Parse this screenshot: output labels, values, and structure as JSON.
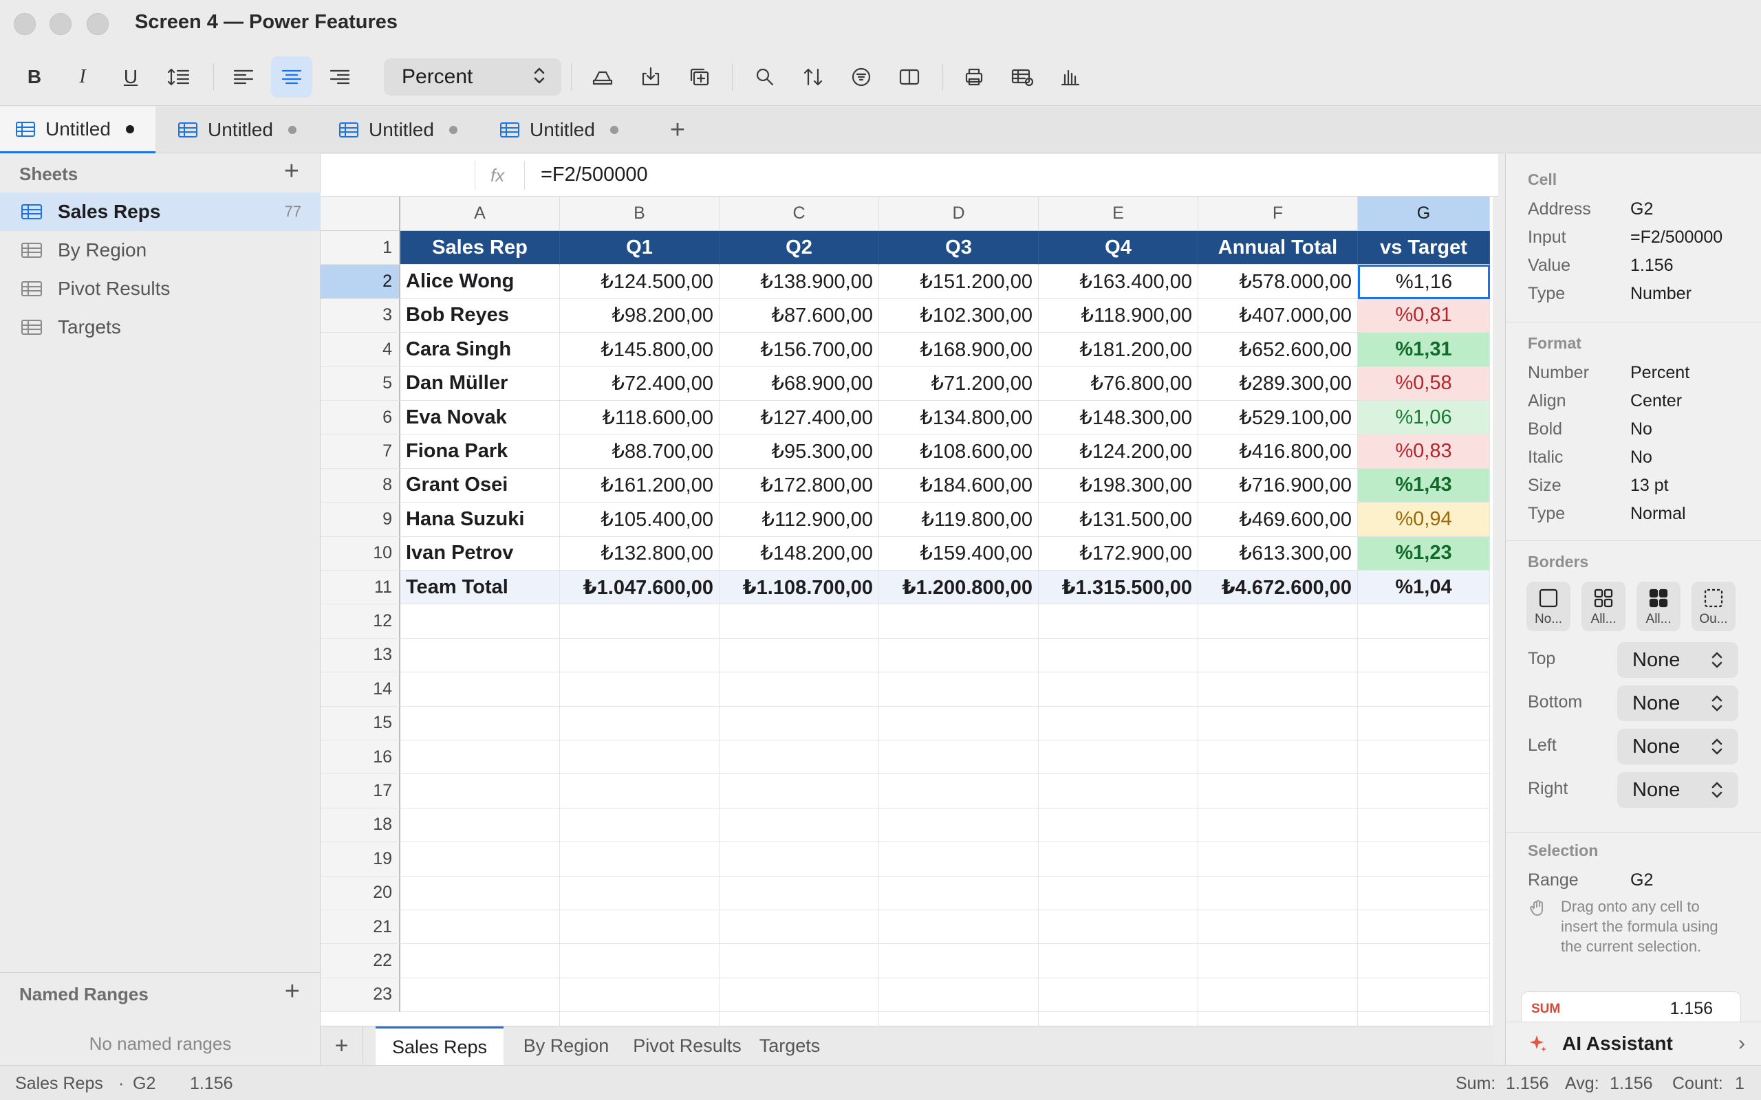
{
  "window": {
    "title": "Screen 4 — Power Features"
  },
  "toolbar": {
    "bold": "B",
    "italic": "I",
    "underline": "U",
    "number_format": "Percent",
    "colors": {
      "active_bg": "#d4e4f8",
      "accent": "#1a73e8"
    }
  },
  "doc_tabs": [
    {
      "label": "Untitled",
      "active": true
    },
    {
      "label": "Untitled",
      "active": false
    },
    {
      "label": "Untitled",
      "active": false
    },
    {
      "label": "Untitled",
      "active": false
    }
  ],
  "sidebar": {
    "header": "Sheets",
    "items": [
      {
        "label": "Sales Reps",
        "count": "77",
        "active": true
      },
      {
        "label": "By Region",
        "count": "",
        "active": false
      },
      {
        "label": "Pivot Results",
        "count": "",
        "active": false
      },
      {
        "label": "Targets",
        "count": "",
        "active": false
      }
    ],
    "named_ranges": {
      "header": "Named Ranges",
      "empty": "No named ranges"
    }
  },
  "formula_bar": {
    "fx": "fx",
    "formula": "=F2/500000"
  },
  "grid": {
    "columns": [
      "A",
      "B",
      "C",
      "D",
      "E",
      "F",
      "G"
    ],
    "selected_column": "G",
    "selected_row": 2,
    "row_numbers": [
      "1",
      "2",
      "3",
      "4",
      "5",
      "6",
      "7",
      "8",
      "9",
      "10",
      "11",
      "12",
      "13",
      "14",
      "15",
      "16",
      "17",
      "18",
      "19",
      "20",
      "21",
      "22",
      "23"
    ],
    "header": [
      "Sales Rep",
      "Q1",
      "Q2",
      "Q3",
      "Q4",
      "Annual Total",
      "vs Target"
    ],
    "rows": [
      {
        "name": "Alice Wong",
        "q": [
          "₺124.500,00",
          "₺138.900,00",
          "₺151.200,00",
          "₺163.400,00"
        ],
        "total": "₺578.000,00",
        "vs": "%1,16",
        "status": "active"
      },
      {
        "name": "Bob Reyes",
        "q": [
          "₺98.200,00",
          "₺87.600,00",
          "₺102.300,00",
          "₺118.900,00"
        ],
        "total": "₺407.000,00",
        "vs": "%0,81",
        "status": "bad"
      },
      {
        "name": "Cara Singh",
        "q": [
          "₺145.800,00",
          "₺156.700,00",
          "₺168.900,00",
          "₺181.200,00"
        ],
        "total": "₺652.600,00",
        "vs": "%1,31",
        "status": "great"
      },
      {
        "name": "Dan Müller",
        "q": [
          "₺72.400,00",
          "₺68.900,00",
          "₺71.200,00",
          "₺76.800,00"
        ],
        "total": "₺289.300,00",
        "vs": "%0,58",
        "status": "bad"
      },
      {
        "name": "Eva Novak",
        "q": [
          "₺118.600,00",
          "₺127.400,00",
          "₺134.800,00",
          "₺148.300,00"
        ],
        "total": "₺529.100,00",
        "vs": "%1,06",
        "status": "ok"
      },
      {
        "name": "Fiona Park",
        "q": [
          "₺88.700,00",
          "₺95.300,00",
          "₺108.600,00",
          "₺124.200,00"
        ],
        "total": "₺416.800,00",
        "vs": "%0,83",
        "status": "bad"
      },
      {
        "name": "Grant Osei",
        "q": [
          "₺161.200,00",
          "₺172.800,00",
          "₺184.600,00",
          "₺198.300,00"
        ],
        "total": "₺716.900,00",
        "vs": "%1,43",
        "status": "great"
      },
      {
        "name": "Hana Suzuki",
        "q": [
          "₺105.400,00",
          "₺112.900,00",
          "₺119.800,00",
          "₺131.500,00"
        ],
        "total": "₺469.600,00",
        "vs": "%0,94",
        "status": "warn"
      },
      {
        "name": "Ivan Petrov",
        "q": [
          "₺132.800,00",
          "₺148.200,00",
          "₺159.400,00",
          "₺172.900,00"
        ],
        "total": "₺613.300,00",
        "vs": "%1,23",
        "status": "great"
      },
      {
        "name": "Team Total",
        "q": [
          "₺1.047.600,00",
          "₺1.108.700,00",
          "₺1.200.800,00",
          "₺1.315.500,00"
        ],
        "total": "₺4.672.600,00",
        "vs": "%1,04",
        "status": "total"
      }
    ],
    "colors": {
      "header_bg": "#1f4e89",
      "bad": "#fbe0e0",
      "great": "#bcecc8",
      "ok": "#d9f3de",
      "warn": "#fdf1cc"
    }
  },
  "sheet_tabs": [
    {
      "label": "Sales Reps",
      "active": true
    },
    {
      "label": "By Region",
      "active": false
    },
    {
      "label": "Pivot Results",
      "active": false
    },
    {
      "label": "Targets",
      "active": false
    }
  ],
  "inspector": {
    "cell_section": "Cell",
    "cell": {
      "address_label": "Address",
      "address": "G2",
      "input_label": "Input",
      "input": "=F2/500000",
      "value_label": "Value",
      "value": "1.156",
      "type_label": "Type",
      "type": "Number"
    },
    "format_section": "Format",
    "format": {
      "number_label": "Number",
      "number": "Percent",
      "align_label": "Align",
      "align": "Center",
      "bold_label": "Bold",
      "bold": "No",
      "italic_label": "Italic",
      "italic": "No",
      "size_label": "Size",
      "size": "13 pt",
      "type_label": "Type",
      "type": "Normal"
    },
    "borders_section": "Borders",
    "border_presets": [
      "No...",
      "All...",
      "All...",
      "Ou..."
    ],
    "borders": {
      "top_label": "Top",
      "top": "None",
      "bottom_label": "Bottom",
      "bottom": "None",
      "left_label": "Left",
      "left": "None",
      "right_label": "Right",
      "right": "None"
    },
    "selection_section": "Selection",
    "selection": {
      "range_label": "Range",
      "range": "G2",
      "hint": "Drag onto any cell to insert the formula using the current selection."
    },
    "sum_card": {
      "label": "SUM",
      "value": "1.156"
    },
    "ai_assistant": "AI Assistant"
  },
  "statusbar": {
    "sheet": "Sales Reps",
    "sep": "·",
    "cell": "G2",
    "value": "1.156",
    "sum_label": "Sum:",
    "sum": "1.156",
    "avg_label": "Avg:",
    "avg": "1.156",
    "count_label": "Count:",
    "count": "1"
  }
}
